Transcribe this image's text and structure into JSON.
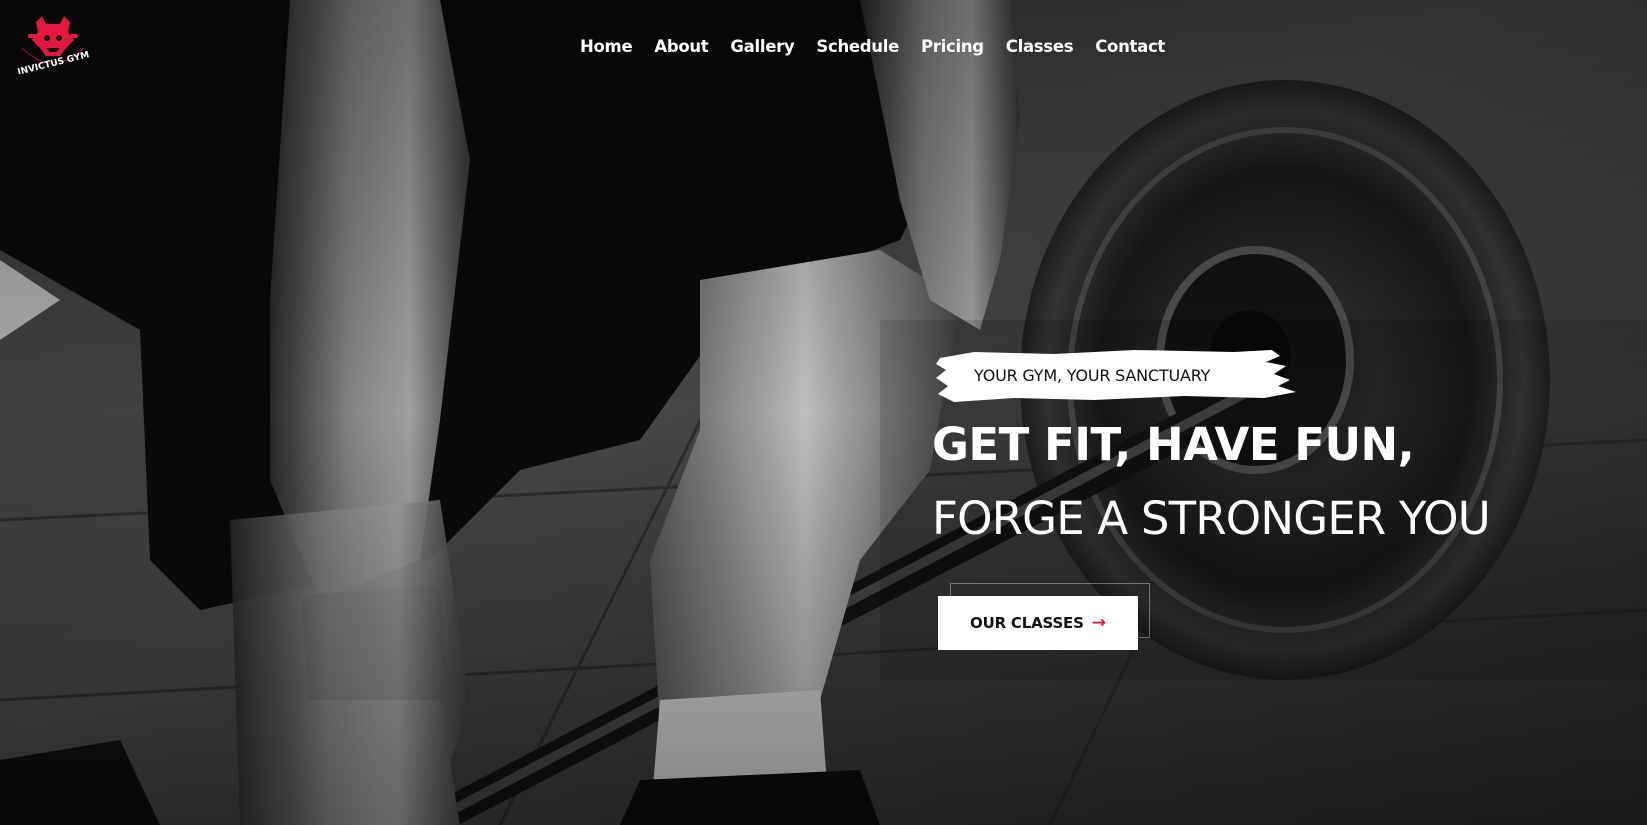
{
  "brand": {
    "logo_text": "INVICTUS GYM",
    "accent": "#e5173f"
  },
  "nav": {
    "items": [
      {
        "label": "Home"
      },
      {
        "label": "About"
      },
      {
        "label": "Gallery"
      },
      {
        "label": "Schedule"
      },
      {
        "label": "Pricing"
      },
      {
        "label": "Classes"
      },
      {
        "label": "Contact"
      }
    ]
  },
  "hero": {
    "tagline": "YOUR GYM, YOUR SANCTUARY",
    "headline_line1": "GET FIT, HAVE FUN,",
    "headline_line2": "FORGE A STRONGER YOU",
    "cta_label": "OUR CLASSES",
    "cta_icon": "arrow-right-icon",
    "background_image": "black-and-white photo of athlete lifting a barbell"
  }
}
